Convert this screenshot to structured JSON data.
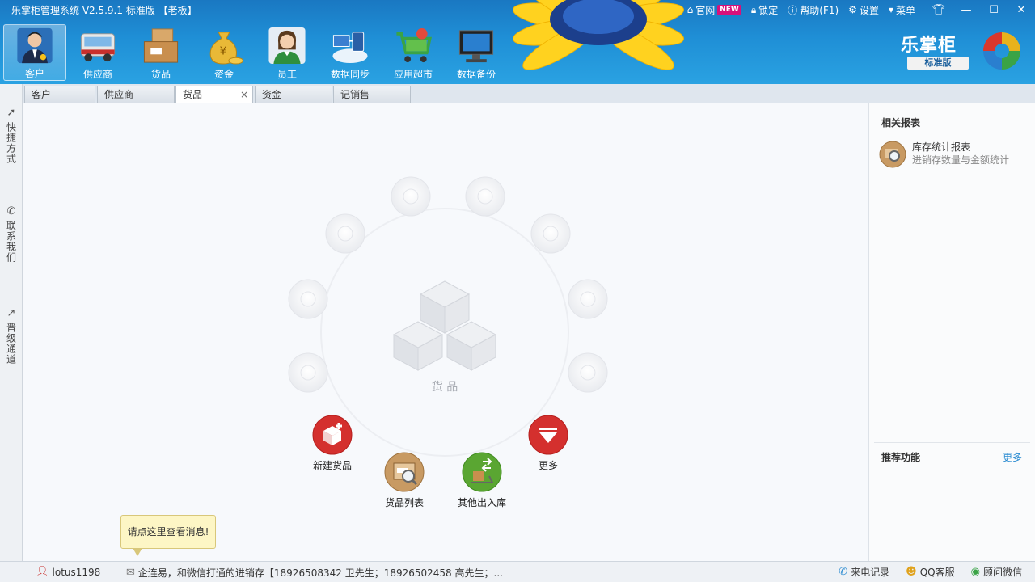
{
  "app": {
    "title": "乐掌柜管理系统 V2.5.9.1 标准版 【老板】",
    "brand_name": "乐掌柜",
    "brand_edition": "标准版"
  },
  "titlebar": {
    "website": "官网",
    "new_badge": "NEW",
    "lock": "锁定",
    "help": "帮助(F1)",
    "settings": "设置",
    "menu": "菜单"
  },
  "nav": [
    {
      "label": "客户",
      "icon": "customer-icon"
    },
    {
      "label": "供应商",
      "icon": "supplier-truck-icon"
    },
    {
      "label": "货品",
      "icon": "goods-box-icon"
    },
    {
      "label": "资金",
      "icon": "money-bag-icon"
    },
    {
      "label": "员工",
      "icon": "employee-icon"
    },
    {
      "label": "数据同步",
      "icon": "data-sync-icon"
    },
    {
      "label": "应用超市",
      "icon": "app-market-cart-icon"
    },
    {
      "label": "数据备份",
      "icon": "data-backup-icon"
    }
  ],
  "tabs": [
    {
      "label": "客户"
    },
    {
      "label": "供应商"
    },
    {
      "label": "货品",
      "active": true
    },
    {
      "label": "资金"
    },
    {
      "label": "记销售"
    }
  ],
  "sidebar": [
    {
      "label": "快捷方式",
      "icon": "shortcut-icon"
    },
    {
      "label": "联系我们",
      "icon": "phone-icon"
    },
    {
      "label": "晋级通道",
      "icon": "upgrade-icon"
    }
  ],
  "hub": {
    "center_label": "货 品",
    "actions": [
      {
        "label": "新建货品",
        "icon": "new-goods-icon"
      },
      {
        "label": "货品列表",
        "icon": "goods-list-icon"
      },
      {
        "label": "其他出入库",
        "icon": "stock-inout-icon"
      },
      {
        "label": "更多",
        "icon": "more-icon"
      }
    ]
  },
  "tooltip": {
    "text": "请点这里查看消息!"
  },
  "right_panel": {
    "reports_title": "相关报表",
    "reports": [
      {
        "name": "库存统计报表",
        "desc": "进销存数量与金额统计"
      }
    ],
    "recommend_title": "推荐功能",
    "more_label": "更多"
  },
  "status": {
    "user": "lotus1198",
    "message": "企连易，和微信打通的进销存【18926508342 卫先生；18926502458 高先生；...",
    "call_log": "来电记录",
    "qq_service": "QQ客服",
    "advisor_wechat": "顾问微信"
  },
  "colors": {
    "header_blue": "#1f8fd6",
    "accent_red": "#d4302e",
    "accent_green": "#5aa632",
    "link_blue": "#2a8bd1"
  }
}
